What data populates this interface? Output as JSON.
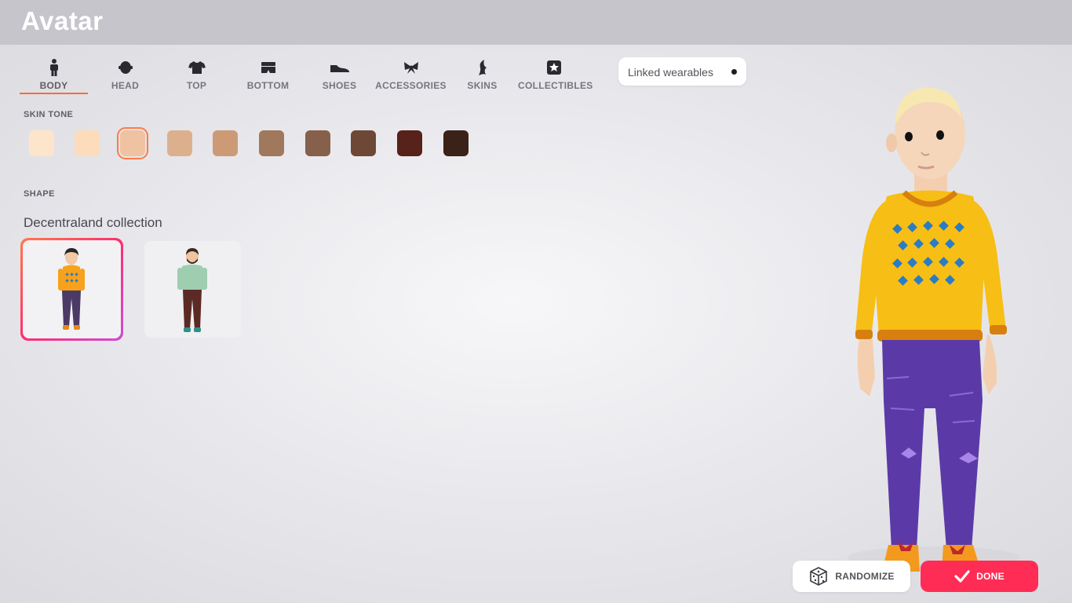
{
  "header": {
    "title": "Avatar"
  },
  "tabs": [
    {
      "label": "BODY",
      "icon": "body-icon"
    },
    {
      "label": "HEAD",
      "icon": "head-icon"
    },
    {
      "label": "TOP",
      "icon": "top-icon"
    },
    {
      "label": "BOTTOM",
      "icon": "bottom-icon"
    },
    {
      "label": "SHOES",
      "icon": "shoes-icon"
    },
    {
      "label": "ACCESSORIES",
      "icon": "accessories-icon"
    },
    {
      "label": "SKINS",
      "icon": "skins-icon"
    },
    {
      "label": "COLLECTIBLES",
      "icon": "collectibles-icon"
    }
  ],
  "active_tab": "BODY",
  "filter": {
    "label": "Linked wearables"
  },
  "skin_tone": {
    "label": "SKIN TONE",
    "colors": [
      "#fde5cb",
      "#fcdcbb",
      "#efc2a2",
      "#ddb08d",
      "#cc9b75",
      "#a0785b",
      "#86604a",
      "#6e4836",
      "#562219",
      "#3a2218"
    ],
    "selected_index": 2,
    "accent": "#ff7a45"
  },
  "shape": {
    "label": "SHAPE",
    "collection_title": "Decentraland collection",
    "options": [
      {
        "name": "female-body-shape",
        "selected": true
      },
      {
        "name": "male-body-shape",
        "selected": false
      }
    ]
  },
  "actions": {
    "randomize_label": "RANDOMIZE",
    "done_label": "DONE",
    "done_color": "#ff2d55"
  }
}
